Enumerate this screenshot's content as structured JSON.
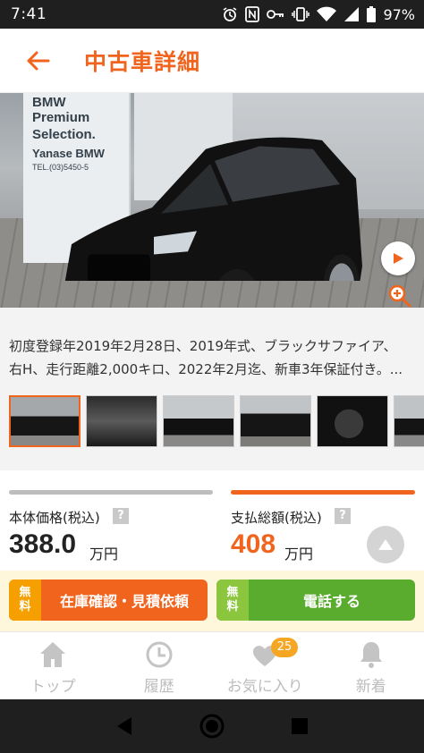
{
  "status_bar": {
    "time": "7:41",
    "battery": "97%"
  },
  "header": {
    "title": "中古車詳細"
  },
  "photo": {
    "sign_lines": [
      "BMW",
      "Premium",
      "Selection.",
      "Yanase BMW",
      "TEL.(03)5450-5"
    ]
  },
  "description": {
    "line1": "初度登録年2019年2月28日、2019年式、ブラックサファイア、",
    "line2": "右H、走行距離2,000キロ、2022年2月迄、新車3年保証付き。..."
  },
  "price": {
    "body_label": "本体価格(税込)",
    "body_value": "388.0",
    "body_unit": "万円",
    "total_label": "支払総額(税込)",
    "total_value": "408",
    "total_unit": "万円",
    "help_mark": "?"
  },
  "actions": {
    "free_label_1": "無",
    "free_label_2": "料",
    "inquiry_label": "在庫確認・見積依頼",
    "call_label": "電話する"
  },
  "bottom_nav": {
    "items": [
      {
        "label": "トップ"
      },
      {
        "label": "履歴"
      },
      {
        "label": "お気に入り",
        "badge": "25"
      },
      {
        "label": "新着"
      }
    ]
  },
  "colors": {
    "accent": "#f0641e",
    "inquiry_btn": "#f0641e",
    "inquiry_badge": "#f5a000",
    "call_btn": "#5aac2e",
    "call_badge": "#8cc63f",
    "action_bg": "#fff7dc"
  }
}
